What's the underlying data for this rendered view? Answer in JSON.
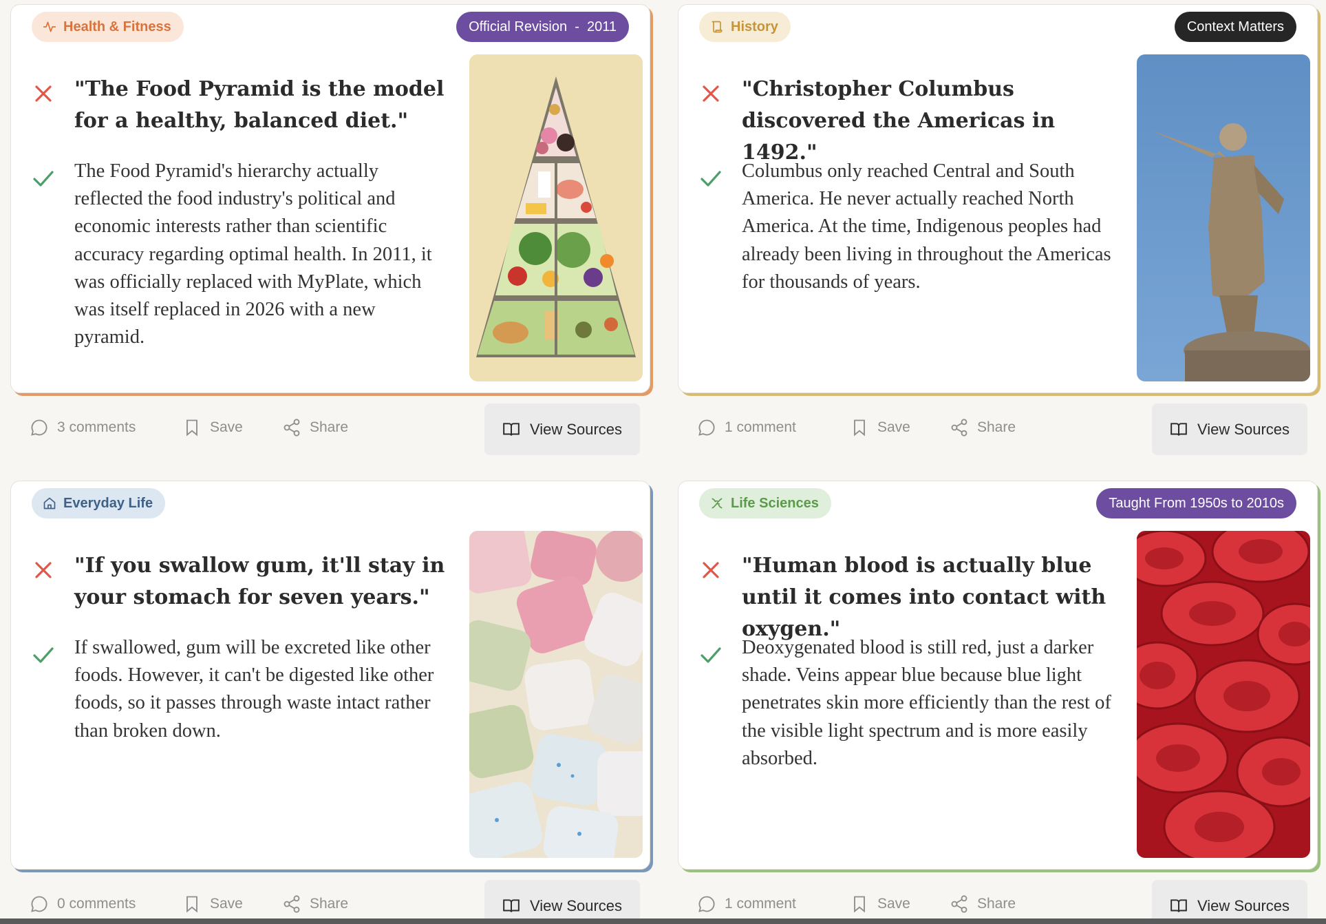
{
  "cards": [
    {
      "category": "Health & Fitness",
      "category_icon": "activity-icon",
      "badge": "Official Revision  -  2011",
      "myth": "\"The Food Pyramid is the model for a healthy, balanced diet.\"",
      "fact": "The Food Pyramid's hierarchy actually reflected the food industry's political and economic interests rather than scientific accuracy regarding optimal health. In 2011, it was officially replaced with MyPlate, which was itself replaced in 2026 with a new pyramid.",
      "comments": "3 comments",
      "save": "Save",
      "share": "Share",
      "sources": "View Sources",
      "accent": "#e49a64"
    },
    {
      "category": "History",
      "category_icon": "scroll-icon",
      "badge": "Context Matters",
      "myth": "\"Christopher Columbus discovered the Americas in 1492.\"",
      "fact": "Columbus only reached Central and South America. He never actually reached North America. At the time, Indigenous peoples had already been living in throughout the Americas for thousands of years.",
      "comments": "1 comment",
      "save": "Save",
      "share": "Share",
      "sources": "View Sources",
      "accent": "#d9bb6f"
    },
    {
      "category": "Everyday Life",
      "category_icon": "home-icon",
      "badge": "",
      "myth": "\"If you swallow gum, it'll stay in your stomach for seven years.\"",
      "fact": "If swallowed, gum will be excreted like other foods. However, it can't be digested like other foods, so it passes through waste intact rather than broken down.",
      "comments": "0 comments",
      "save": "Save",
      "share": "Share",
      "sources": "View Sources",
      "accent": "#7c98b8"
    },
    {
      "category": "Life Sciences",
      "category_icon": "dna-icon",
      "badge": "Taught From 1950s to 2010s",
      "myth": "\"Human blood is actually blue until it comes into contact with oxygen.\"",
      "fact": "Deoxygenated blood is still red, just a darker shade. Veins appear blue because blue light penetrates skin more efficiently than the rest of the visible light spectrum and is more easily absorbed.",
      "comments": "1 comment",
      "save": "Save",
      "share": "Share",
      "sources": "View Sources",
      "accent": "#99c27f"
    }
  ],
  "colors": {
    "myth_x": "#e0574a",
    "fact_check": "#4e9e6a",
    "purple_badge": "#6c4da0",
    "dark_badge": "#262626"
  }
}
